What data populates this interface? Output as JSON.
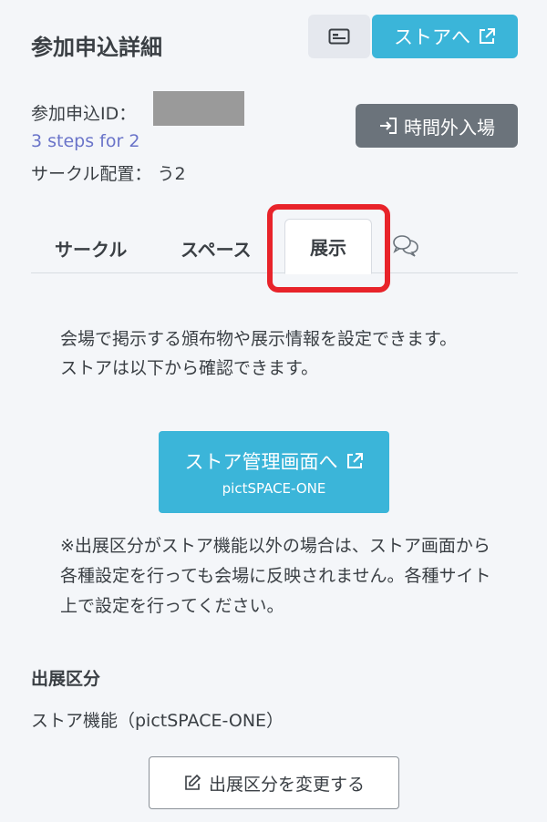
{
  "header": {
    "title": "参加申込詳細",
    "card_icon": "id-card-icon",
    "store_button": "ストアへ",
    "external_icon": "external-link-icon"
  },
  "info": {
    "id_label": "参加申込ID：",
    "circle_name": "3 steps for 2",
    "placement": "サークル配置： う2",
    "late_entry_button": "時間外入場"
  },
  "tabs": {
    "circle": "サークル",
    "space": "スペース",
    "display": "展示",
    "chat_icon": "chat-bubbles-icon"
  },
  "main": {
    "desc_line1": "会場で掲示する頒布物や展示情報を設定できます。",
    "desc_line2": "ストアは以下から確認できます。",
    "manage_button": "ストア管理画面へ",
    "manage_sub": "pictSPACE-ONE",
    "note": "※出展区分がストア機能以外の場合は、ストア画面から各種設定を行っても会場に反映されません。各種サイト上で設定を行ってください。"
  },
  "exhibit": {
    "title": "出展区分",
    "value": "ストア機能（pictSPACE-ONE）",
    "change_button": "出展区分を変更する"
  },
  "colors": {
    "accent": "#3bb5d9",
    "secondary": "#6b737b",
    "link": "#6a74c9",
    "highlight": "#e8232a"
  }
}
